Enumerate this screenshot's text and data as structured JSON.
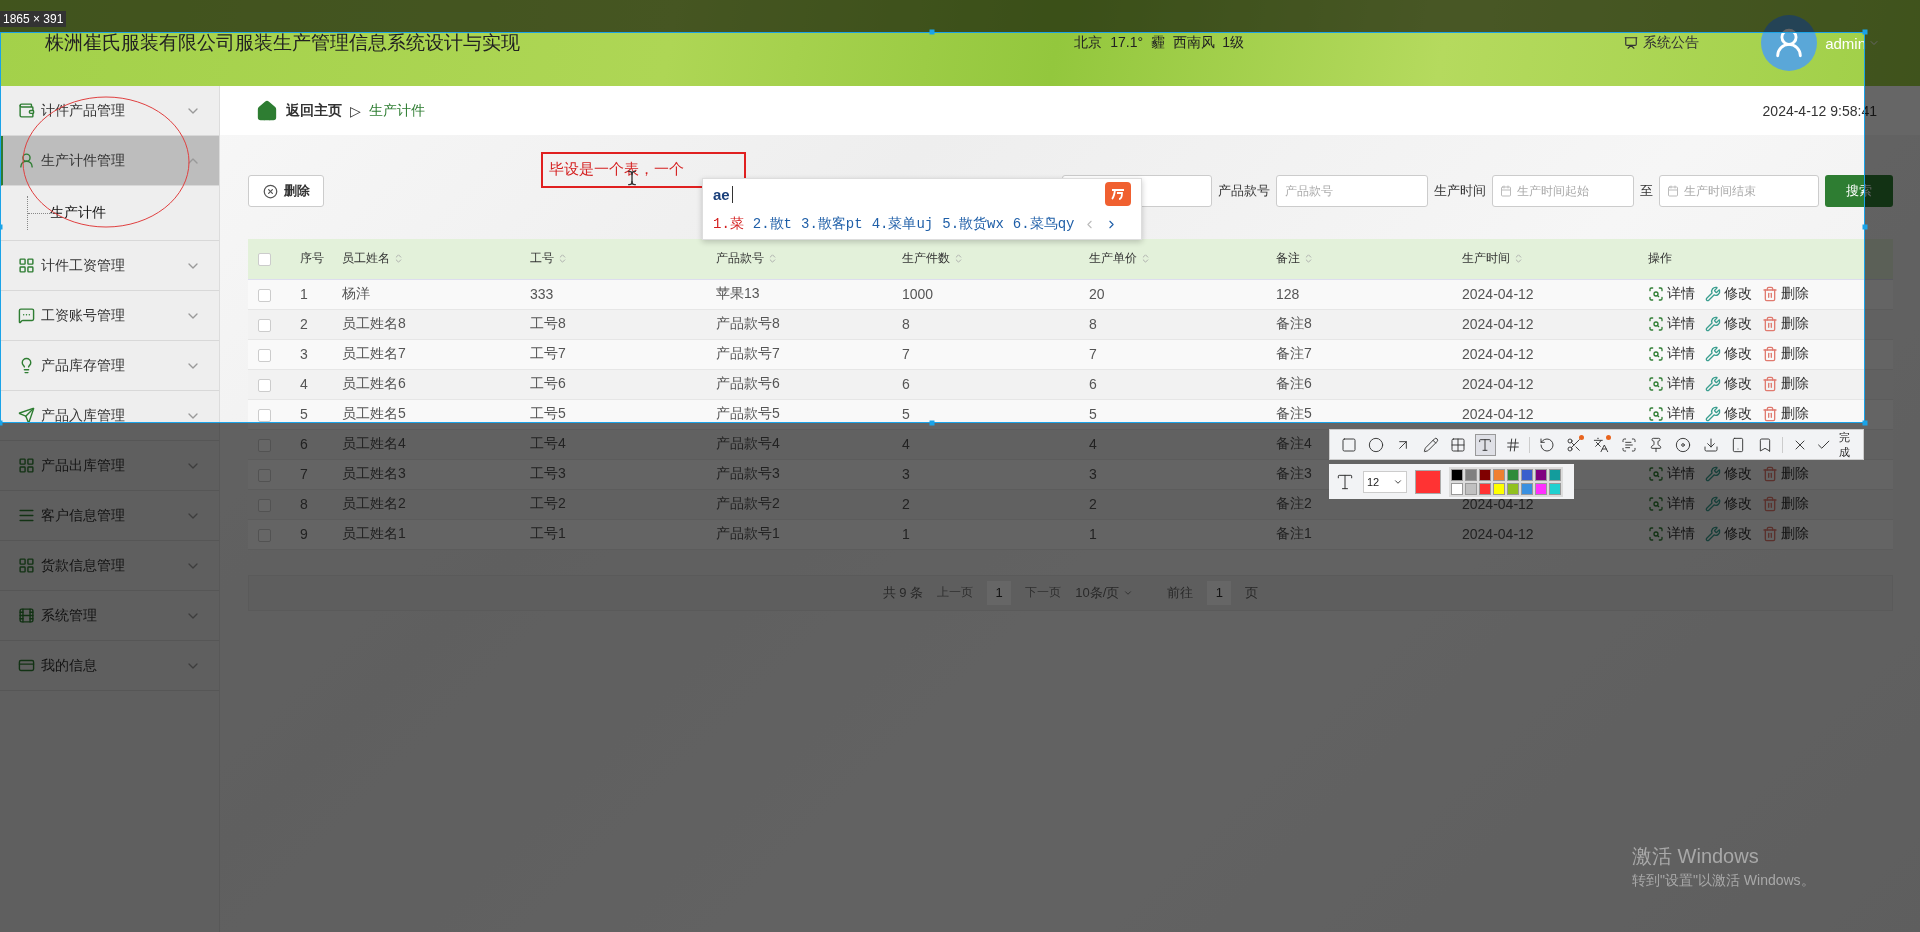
{
  "screenshot_tool": {
    "size_label": "1865 × 391"
  },
  "header": {
    "title": "株洲崔氏服装有限公司服装生产管理信息系统设计与实现",
    "weather": "北京  17.1°  霾  西南风  1级",
    "notice": "系统公告",
    "user": "admin"
  },
  "sidebar": {
    "items": [
      {
        "label": "计件产品管理",
        "selected": false,
        "expanded": false
      },
      {
        "label": "生产计件管理",
        "selected": true,
        "expanded": true,
        "children": [
          {
            "label": "生产计件"
          }
        ]
      },
      {
        "label": "计件工资管理",
        "selected": false,
        "expanded": false
      },
      {
        "label": "工资账号管理",
        "selected": false,
        "expanded": false
      },
      {
        "label": "产品库存管理",
        "selected": false,
        "expanded": false
      },
      {
        "label": "产品入库管理",
        "selected": false,
        "expanded": false
      },
      {
        "label": "产品出库管理",
        "selected": false,
        "expanded": false
      },
      {
        "label": "客户信息管理",
        "selected": false,
        "expanded": false
      },
      {
        "label": "货款信息管理",
        "selected": false,
        "expanded": false
      },
      {
        "label": "系统管理",
        "selected": false,
        "expanded": false
      },
      {
        "label": "我的信息",
        "selected": false,
        "expanded": false
      }
    ]
  },
  "breadcrumb": {
    "home": "返回主页",
    "separator": "▷",
    "current": "生产计件"
  },
  "datetime": "2024-4-12 9:58:41",
  "delete_button": "删除",
  "search": {
    "fields": [
      {
        "kind": "text"
      },
      {
        "kind": "text",
        "label": "产品款号",
        "placeholder": "产品款号"
      },
      {
        "kind": "date",
        "label": "生产时间",
        "placeholder": "生产时间起始"
      },
      {
        "kind": "date",
        "label": "至",
        "placeholder": "生产时间结束"
      }
    ],
    "button": "搜索"
  },
  "table": {
    "select_all": {
      "checked": false
    },
    "columns": [
      {
        "label": "序号",
        "sortable": false
      },
      {
        "label": "员工姓名",
        "sortable": true
      },
      {
        "label": "工号",
        "sortable": true
      },
      {
        "label": "产品款号",
        "sortable": true
      },
      {
        "label": "生产件数",
        "sortable": true
      },
      {
        "label": "生产单价",
        "sortable": true
      },
      {
        "label": "备注",
        "sortable": true
      },
      {
        "label": "生产时间",
        "sortable": true
      },
      {
        "label": "操作",
        "sortable": false
      }
    ],
    "rows": [
      {
        "checked": false,
        "cells": [
          "1",
          "杨洋",
          "333",
          "苹果13",
          "1000",
          "20",
          "128",
          "2024-04-12"
        ],
        "actions": [
          {
            "kind": "detail",
            "label": "详情"
          },
          {
            "kind": "edit",
            "label": "修改"
          },
          {
            "kind": "delete",
            "label": "删除"
          }
        ]
      },
      {
        "checked": false,
        "cells": [
          "2",
          "员工姓名8",
          "工号8",
          "产品款号8",
          "8",
          "8",
          "备注8",
          "2024-04-12"
        ],
        "actions": [
          {
            "kind": "detail",
            "label": "详情"
          },
          {
            "kind": "edit",
            "label": "修改"
          },
          {
            "kind": "delete",
            "label": "删除"
          }
        ]
      },
      {
        "checked": false,
        "cells": [
          "3",
          "员工姓名7",
          "工号7",
          "产品款号7",
          "7",
          "7",
          "备注7",
          "2024-04-12"
        ],
        "actions": [
          {
            "kind": "detail",
            "label": "详情"
          },
          {
            "kind": "edit",
            "label": "修改"
          },
          {
            "kind": "delete",
            "label": "删除"
          }
        ]
      },
      {
        "checked": false,
        "cells": [
          "4",
          "员工姓名6",
          "工号6",
          "产品款号6",
          "6",
          "6",
          "备注6",
          "2024-04-12"
        ],
        "actions": [
          {
            "kind": "detail",
            "label": "详情"
          },
          {
            "kind": "edit",
            "label": "修改"
          },
          {
            "kind": "delete",
            "label": "删除"
          }
        ]
      },
      {
        "checked": false,
        "cells": [
          "5",
          "员工姓名5",
          "工号5",
          "产品款号5",
          "5",
          "5",
          "备注5",
          "2024-04-12"
        ],
        "actions": [
          {
            "kind": "detail",
            "label": "详情"
          },
          {
            "kind": "edit",
            "label": "修改"
          },
          {
            "kind": "delete",
            "label": "删除"
          }
        ]
      },
      {
        "checked": false,
        "cells": [
          "6",
          "员工姓名4",
          "工号4",
          "产品款号4",
          "4",
          "4",
          "备注4"
        ]
      },
      {
        "checked": false,
        "cells": [
          "7",
          "员工姓名3",
          "工号3",
          "产品款号3",
          "3",
          "3",
          "备注3"
        ],
        "actions": [
          {
            "kind": "detail",
            "label": "详情"
          },
          {
            "kind": "edit",
            "label": "修改"
          },
          {
            "kind": "delete",
            "label": "删除"
          }
        ]
      },
      {
        "checked": false,
        "cells": [
          "8",
          "员工姓名2",
          "工号2",
          "产品款号2",
          "2",
          "2",
          "备注2",
          "2024-04-12"
        ],
        "actions": [
          {
            "kind": "detail",
            "label": "详情"
          },
          {
            "kind": "edit",
            "label": "修改"
          },
          {
            "kind": "delete",
            "label": "删除"
          }
        ]
      },
      {
        "checked": false,
        "cells": [
          "9",
          "员工姓名1",
          "工号1",
          "产品款号1",
          "1",
          "1",
          "备注1",
          "2024-04-12"
        ],
        "actions": [
          {
            "kind": "detail",
            "label": "详情"
          },
          {
            "kind": "edit",
            "label": "修改"
          },
          {
            "kind": "delete",
            "label": "删除"
          }
        ]
      }
    ]
  },
  "pagination": {
    "total": "共 9 条",
    "prev": "上一页",
    "page": "1",
    "next": "下一页",
    "page_size": "10条/页",
    "goto": "前往",
    "goto_value": "1",
    "page_unit": "页"
  },
  "annotation": {
    "text": "毕设是一个表，一个"
  },
  "ime": {
    "composition": "ae",
    "candidates": [
      {
        "label": "1.菜",
        "selected": true
      },
      {
        "label": "2.散t",
        "selected": false
      },
      {
        "label": "3.散客pt",
        "selected": false
      },
      {
        "label": "4.菜单uj",
        "selected": false
      },
      {
        "label": "5.散货wx",
        "selected": false
      },
      {
        "label": "6.菜鸟qy",
        "selected": false
      }
    ]
  },
  "tool_bar": {
    "tools": [
      {
        "kind": "rect",
        "selected": false,
        "badge": false
      },
      {
        "kind": "ellipse",
        "selected": false,
        "badge": false
      },
      {
        "kind": "arrow",
        "selected": false,
        "badge": false
      },
      {
        "kind": "pen",
        "selected": false,
        "badge": false
      },
      {
        "kind": "mosaic",
        "selected": false,
        "badge": false
      },
      {
        "kind": "text",
        "selected": true,
        "badge": false
      },
      {
        "kind": "number",
        "selected": false,
        "badge": false
      },
      {
        "kind": "undo",
        "selected": false,
        "badge": false
      },
      {
        "kind": "cutout",
        "selected": false,
        "badge": true
      },
      {
        "kind": "translate",
        "selected": false,
        "badge": true
      },
      {
        "kind": "ocr",
        "selected": false,
        "badge": false
      },
      {
        "kind": "pin",
        "selected": false,
        "badge": false
      },
      {
        "kind": "record",
        "selected": false,
        "badge": false
      },
      {
        "kind": "save",
        "selected": false,
        "badge": false
      },
      {
        "kind": "phone",
        "selected": false,
        "badge": false
      },
      {
        "kind": "bookmark",
        "selected": false,
        "badge": false
      },
      {
        "kind": "close",
        "selected": false,
        "badge": false
      }
    ],
    "done": "完成"
  },
  "text_options": {
    "font_size": "12",
    "current": {
      "color": "#ff3333"
    },
    "palette": [
      {
        "color": "#000000"
      },
      {
        "color": "#808080"
      },
      {
        "color": "#800000"
      },
      {
        "color": "#f08030"
      },
      {
        "color": "#2e8b3a"
      },
      {
        "color": "#3a5fcd"
      },
      {
        "color": "#800080"
      },
      {
        "color": "#139c9c"
      },
      {
        "color": "#ffffff"
      },
      {
        "color": "#c0c0c0"
      },
      {
        "color": "#ff3333"
      },
      {
        "color": "#ffff00"
      },
      {
        "color": "#90c020"
      },
      {
        "color": "#3a90e0"
      },
      {
        "color": "#ff30ff"
      },
      {
        "color": "#20d0d0"
      }
    ]
  },
  "watermark": {
    "title": "激活 Windows",
    "subtitle": "转到\"设置\"以激活 Windows。"
  }
}
